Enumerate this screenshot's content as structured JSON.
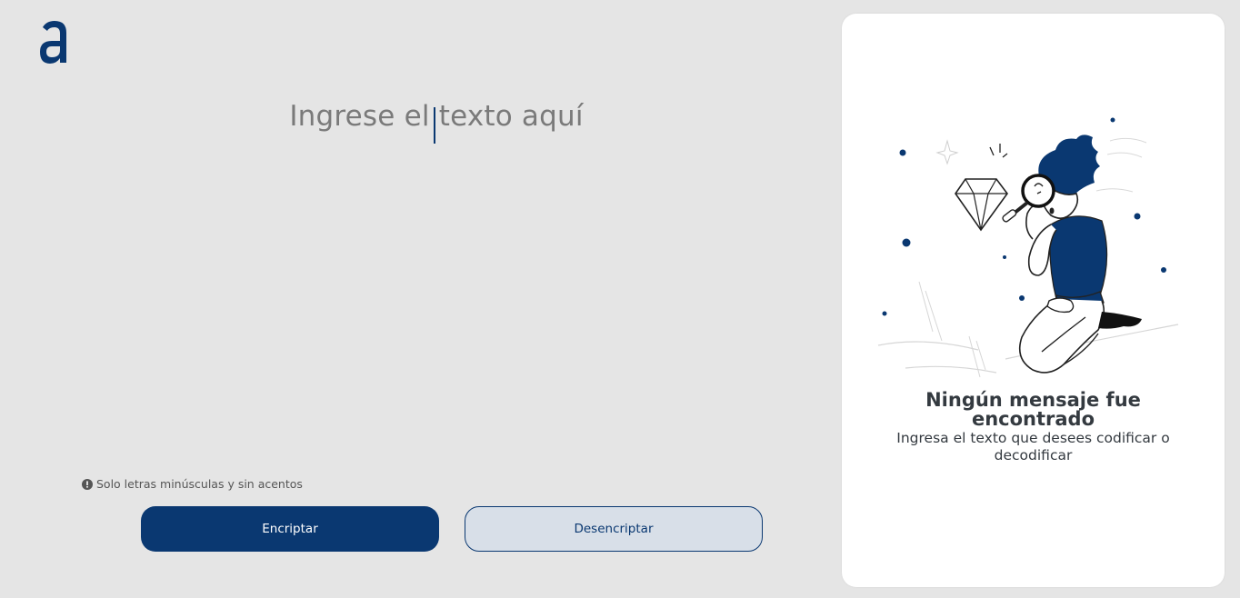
{
  "logo": {
    "letter": "a",
    "icon": "alura-logo-icon"
  },
  "editor": {
    "placeholder": "Ingrese el texto aquí"
  },
  "hint": {
    "text": "Solo letras minúsculas y sin acentos",
    "icon": "info-icon"
  },
  "buttons": {
    "encrypt": "Encriptar",
    "decrypt": "Desencriptar"
  },
  "panel": {
    "title": "Ningún mensaje fue encontrado",
    "subtitle": "Ingresa el texto que desees codificar o decodificar",
    "illustration": "person-with-magnifier-illustration"
  },
  "colors": {
    "accent": "#0a3871",
    "background": "#e5e5e5",
    "panel": "#ffffff",
    "text_dark": "#343a40",
    "placeholder": "#7a7a7a"
  }
}
